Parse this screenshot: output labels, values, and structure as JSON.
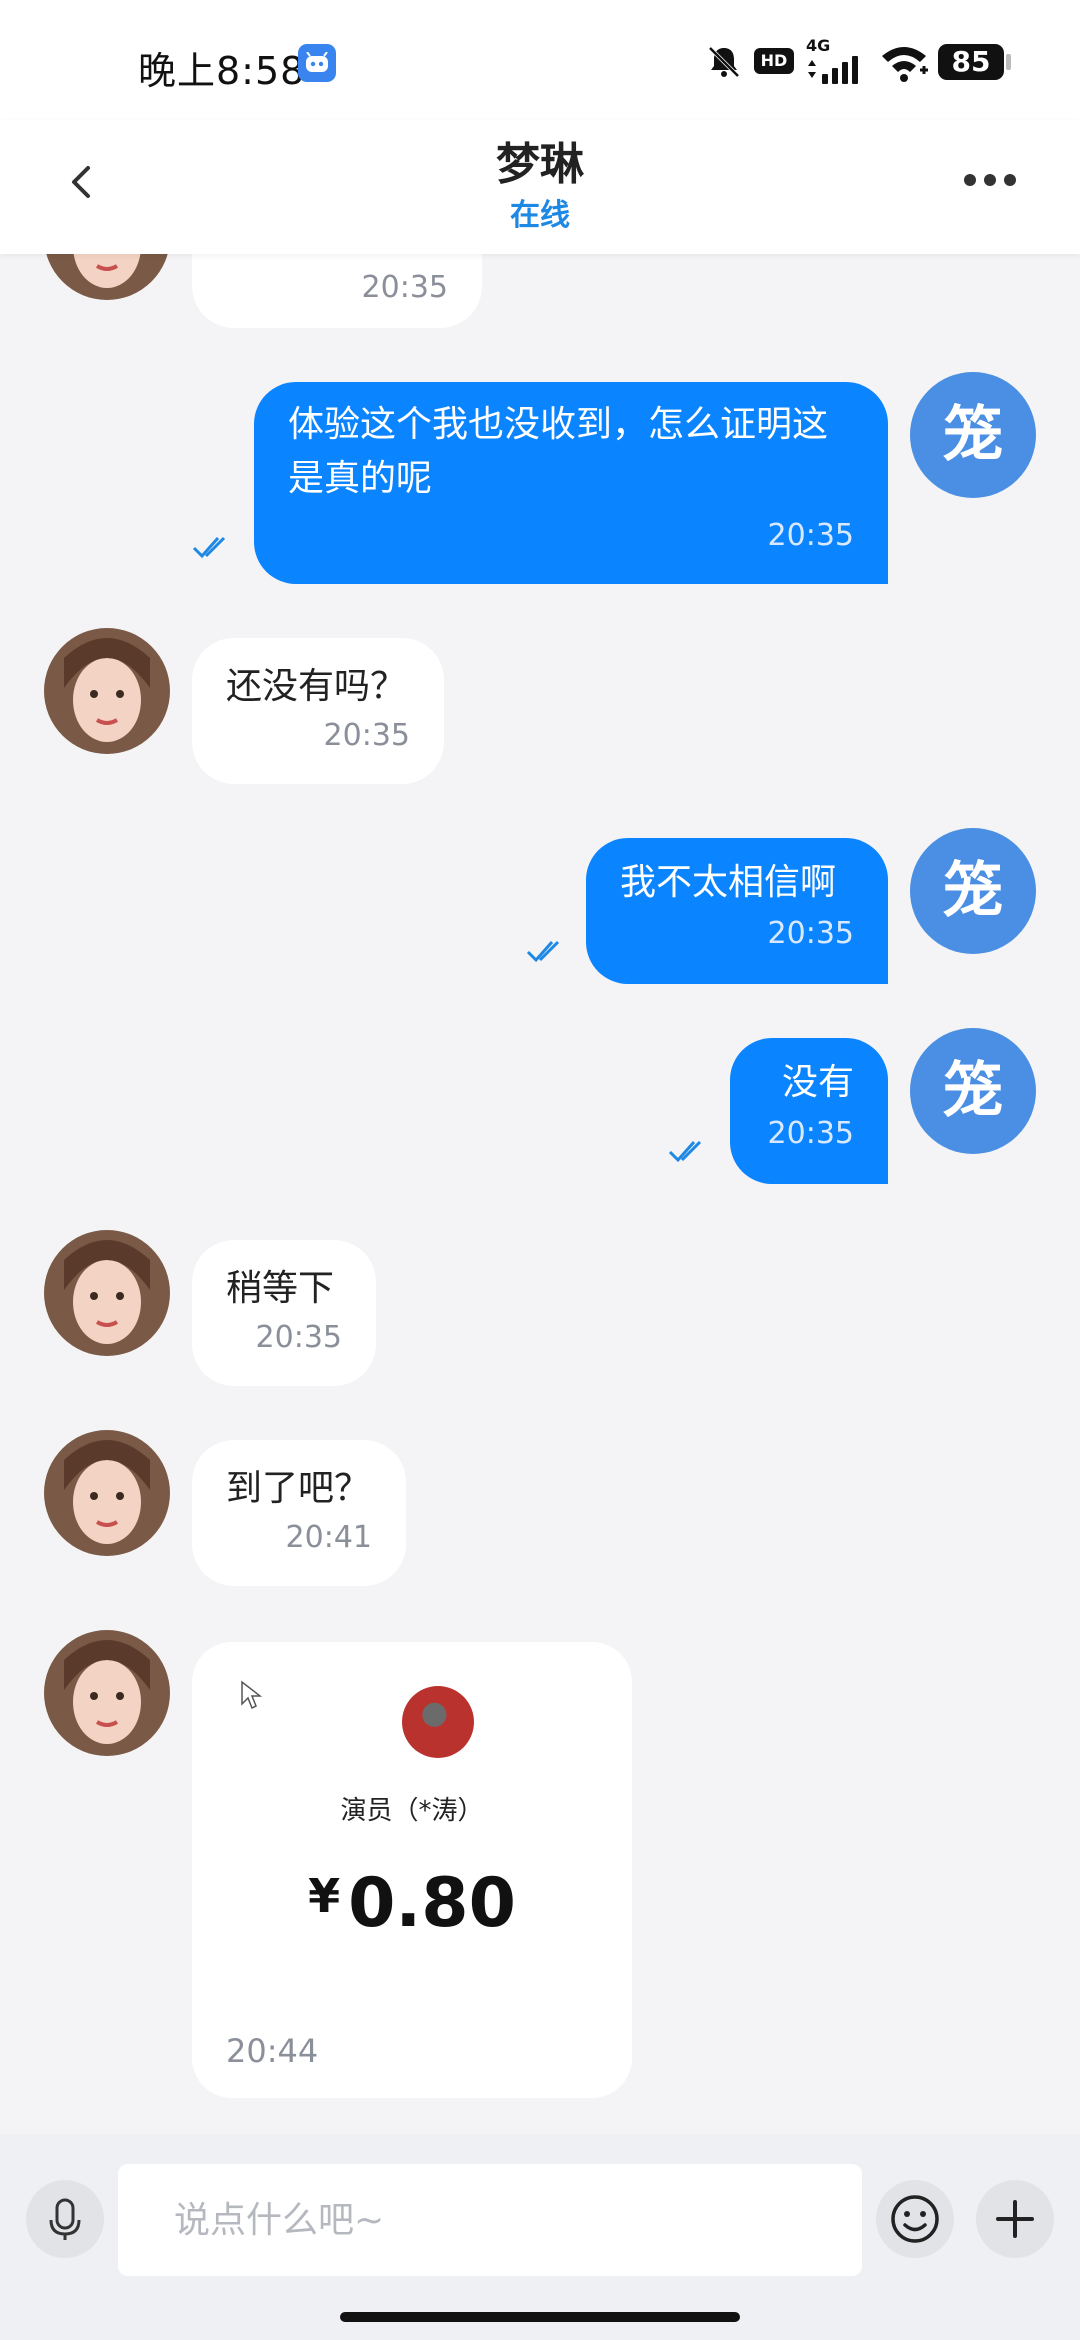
{
  "status_bar": {
    "time": "晚上8:58",
    "network": "4G",
    "hd": "HD",
    "battery": "85"
  },
  "header": {
    "title": "梦琳",
    "status": "在线"
  },
  "me": {
    "avatar_char": "笼"
  },
  "messages": [
    {
      "side": "in",
      "text": "",
      "time": "20:35"
    },
    {
      "side": "out",
      "text": "体验这个我也没收到，怎么证明这是真的呢",
      "time": "20:35"
    },
    {
      "side": "in",
      "text": "还没有吗？",
      "time": "20:35"
    },
    {
      "side": "out",
      "text": "我不太相信啊",
      "time": "20:35"
    },
    {
      "side": "out",
      "text": "没有",
      "time": "20:35"
    },
    {
      "side": "in",
      "text": "稍等下",
      "time": "20:35"
    },
    {
      "side": "in",
      "text": "到了吧？",
      "time": "20:41"
    }
  ],
  "transfer": {
    "payer": "演员（*涛）",
    "currency": "¥",
    "amount": "0.80",
    "time": "20:44"
  },
  "input": {
    "placeholder": "说点什么吧~"
  },
  "colors": {
    "accent": "#0a84ff",
    "status_online": "#1e88e5",
    "my_avatar": "#4a8fe4"
  }
}
